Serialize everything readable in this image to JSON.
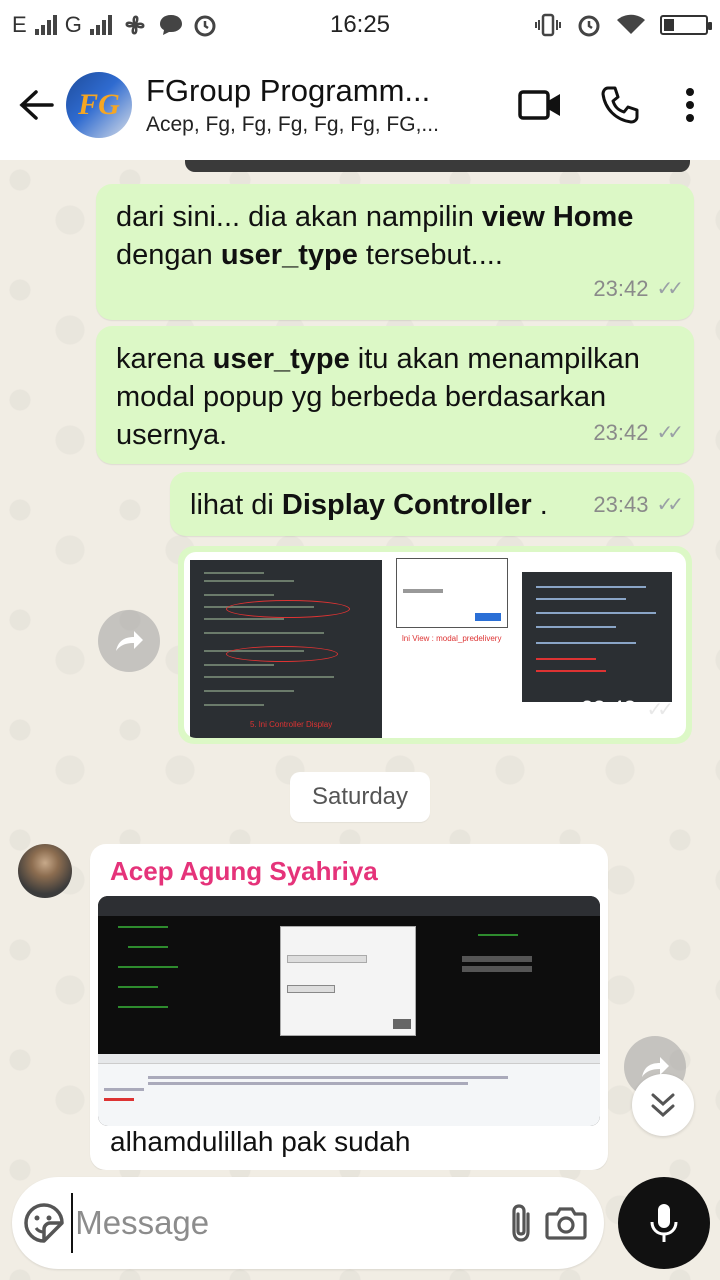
{
  "status_bar": {
    "left_text": "E",
    "network_label": "G",
    "time": "16:25"
  },
  "header": {
    "avatar_text": "FG",
    "title": "FGroup Programm...",
    "subtitle": "Acep, Fg, Fg, Fg, Fg, Fg, FG,..."
  },
  "messages": [
    {
      "parts": [
        {
          "t": "dari sini... dia akan nampilin ",
          "b": false
        },
        {
          "t": "view Home",
          "b": true
        },
        {
          "t": " dengan ",
          "b": false
        },
        {
          "t": "user_type",
          "b": true
        },
        {
          "t": " tersebut....",
          "b": false
        }
      ],
      "time": "23:42"
    },
    {
      "parts": [
        {
          "t": "karena ",
          "b": false
        },
        {
          "t": "user_type",
          "b": true
        },
        {
          "t": " itu akan menampilkan modal popup yg berbeda berdasarkan usernya.",
          "b": false
        }
      ],
      "time": "23:42"
    },
    {
      "parts": [
        {
          "t": "lihat di ",
          "b": false
        },
        {
          "t": "Display Controller",
          "b": true
        },
        {
          "t": " .",
          "b": false
        }
      ],
      "time": "23:43"
    }
  ],
  "image_message": {
    "time": "23:43",
    "captions": {
      "controller": "5. lni Controller Display",
      "view": "lni View : modal_predelivery"
    }
  },
  "date_chip": "Saturday",
  "incoming": {
    "sender": "Acep Agung Syahriya",
    "text": "alhamdulillah pak sudah"
  },
  "composer": {
    "placeholder": "Message"
  },
  "colors": {
    "outgoing_bubble": "#dcf8c6",
    "sender_name": "#e5337a",
    "mic_button": "#111111"
  },
  "icons": {
    "back": "arrow-left-icon",
    "video": "video-camera-icon",
    "call": "phone-icon",
    "menu": "more-vertical-icon",
    "forward": "forward-icon",
    "scroll": "double-chevron-down-icon",
    "emoji": "sticker-icon",
    "attach": "paperclip-icon",
    "camera": "camera-icon",
    "mic": "microphone-icon"
  }
}
